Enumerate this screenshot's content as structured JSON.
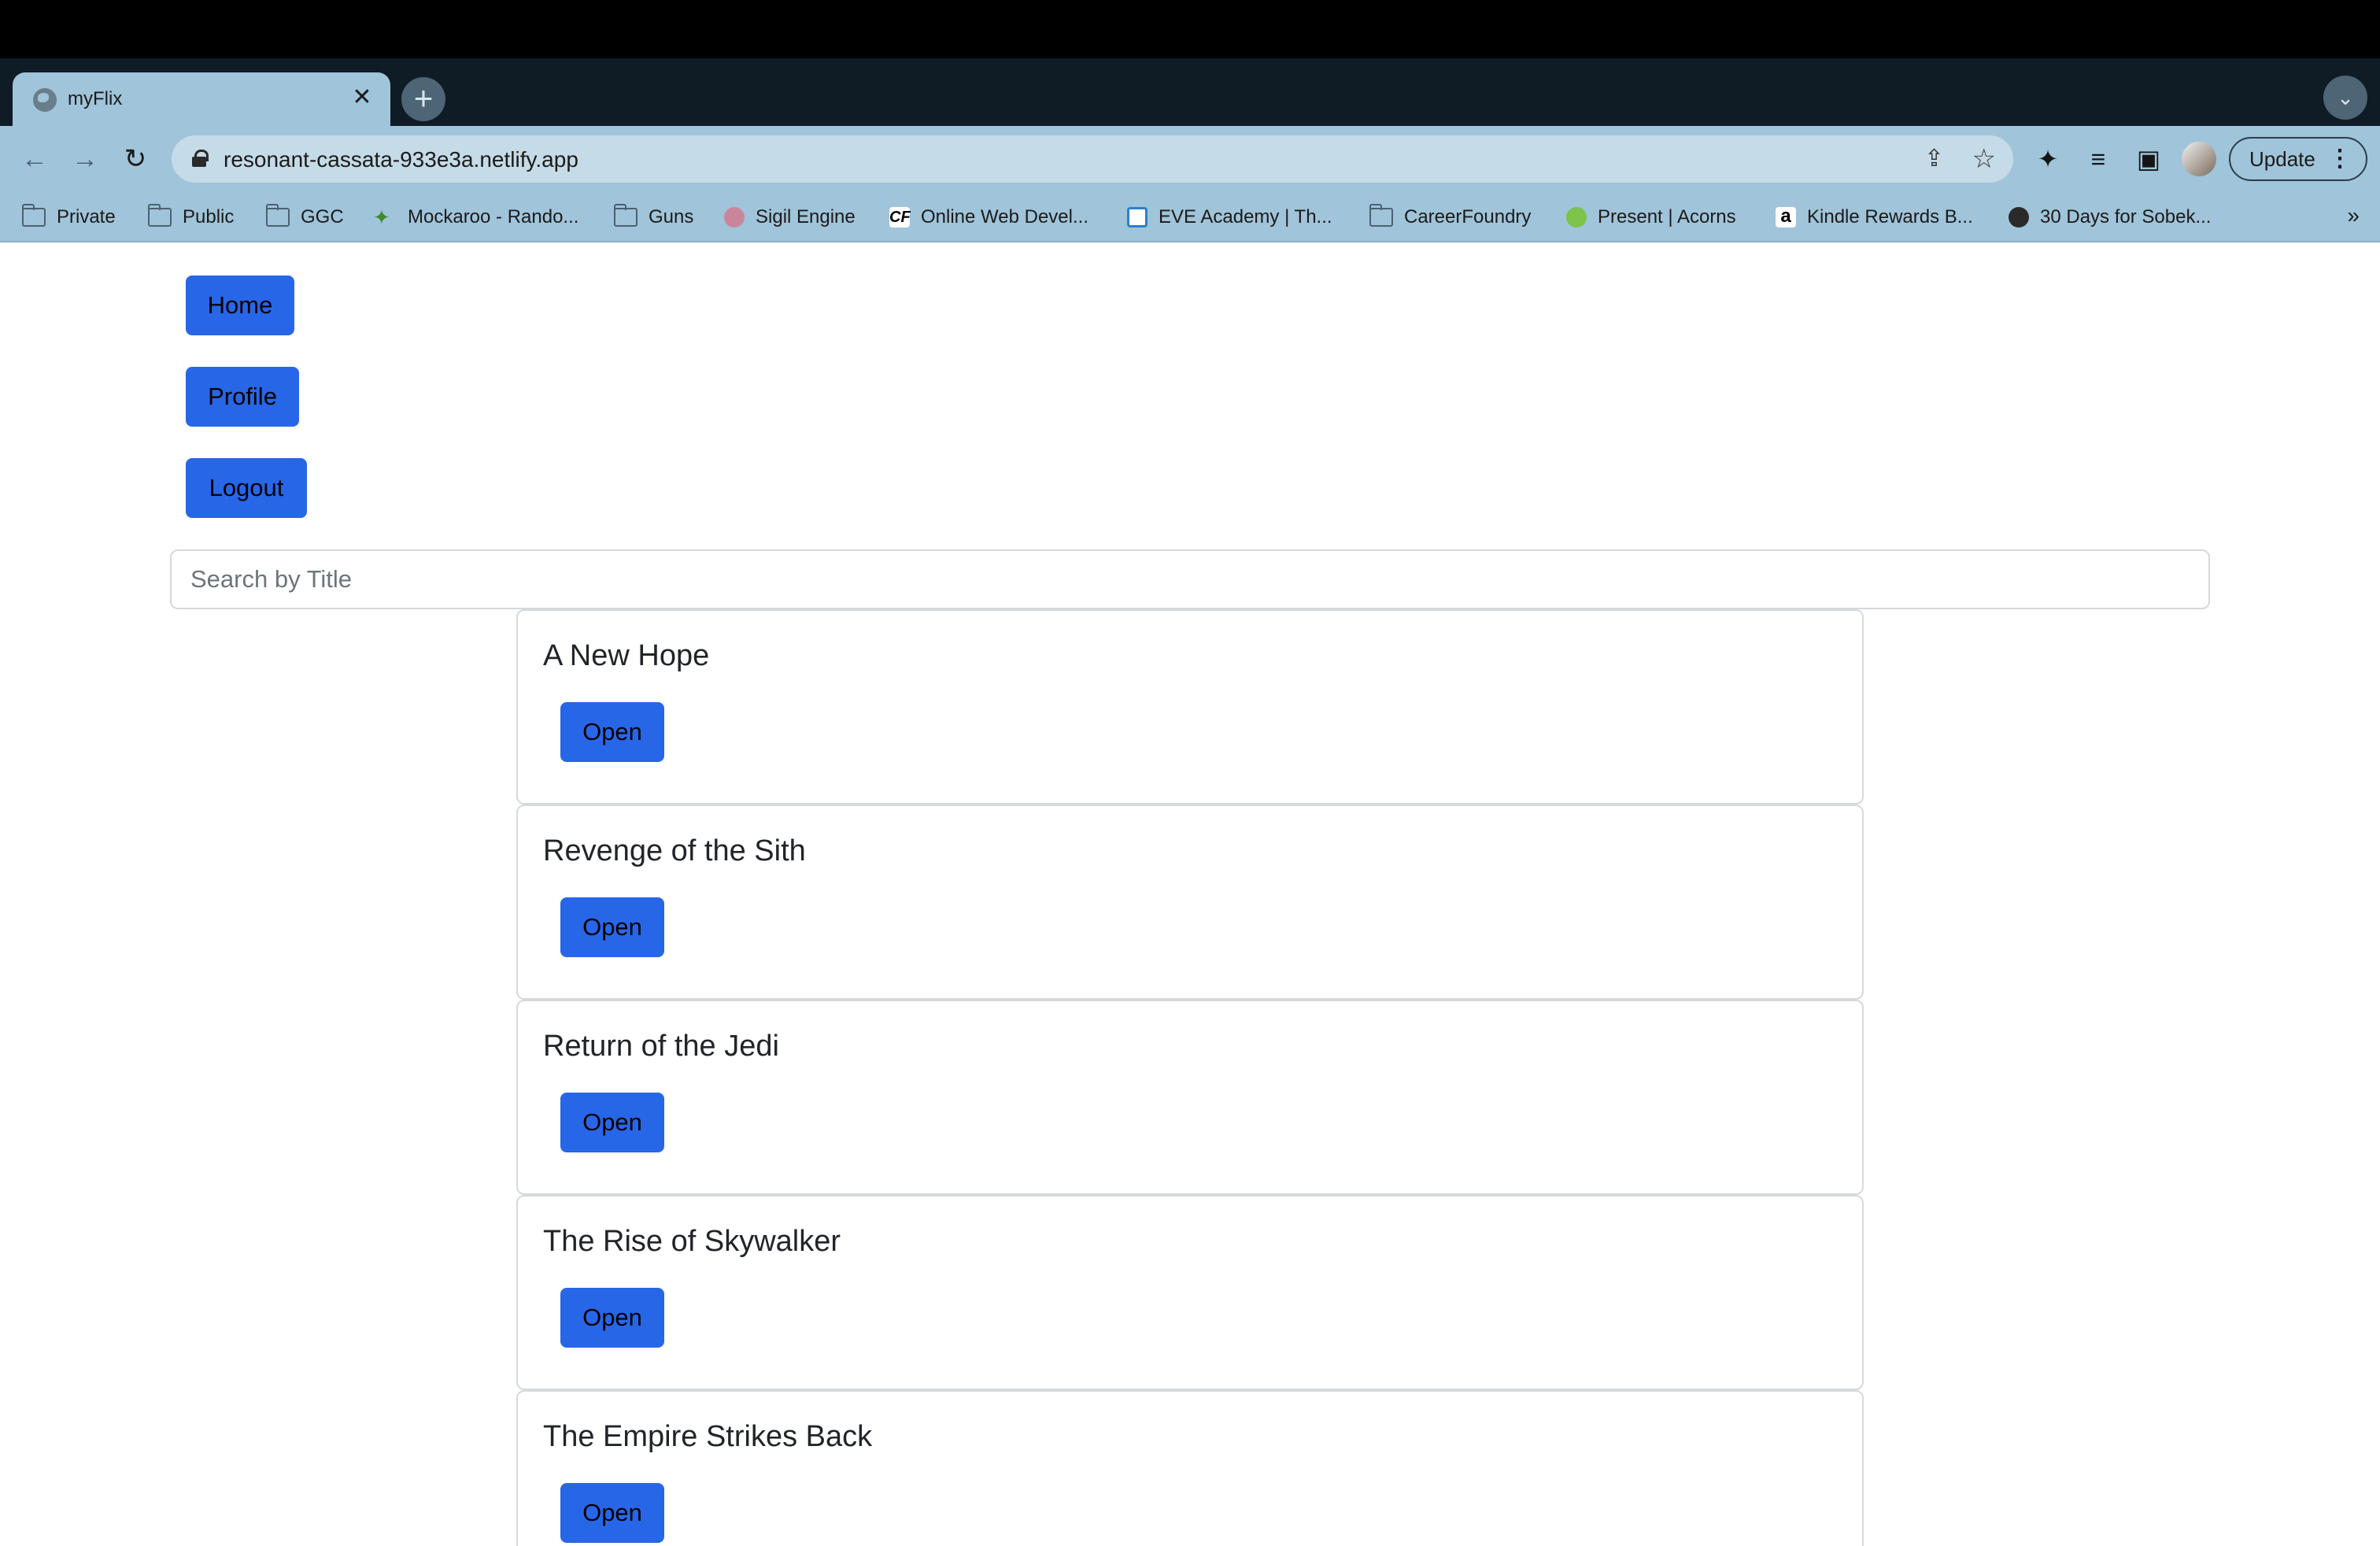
{
  "browser": {
    "tab": {
      "title": "myFlix",
      "close": "✕"
    },
    "new_tab": "+",
    "tab_menu": "⌄",
    "toolbar": {
      "back": "←",
      "forward": "→",
      "reload": "↻",
      "url": "resonant-cassata-933e3a.netlify.app",
      "update_label": "Update",
      "menu": "⋮"
    },
    "bookmarks": [
      {
        "label": "Private",
        "icon": "folder-icon"
      },
      {
        "label": "Public",
        "icon": "folder-icon"
      },
      {
        "label": "GGC",
        "icon": "folder-icon"
      },
      {
        "label": "Mockaroo - Rando...",
        "icon": "mockaroo-icon"
      },
      {
        "label": "Guns",
        "icon": "folder-icon"
      },
      {
        "label": "Sigil Engine",
        "icon": "sigil-icon"
      },
      {
        "label": "Online Web Devel...",
        "icon": "cf-icon",
        "icon_text": "CF"
      },
      {
        "label": "EVE Academy | Th...",
        "icon": "eve-icon"
      },
      {
        "label": "CareerFoundry",
        "icon": "folder-icon"
      },
      {
        "label": "Present | Acorns",
        "icon": "acorns-icon"
      },
      {
        "label": "Kindle Rewards B...",
        "icon": "amazon-icon",
        "icon_text": "a"
      },
      {
        "label": "30 Days for Sobek...",
        "icon": "globe-icon"
      }
    ],
    "bookmarks_more": "»"
  },
  "app": {
    "nav": {
      "home": "Home",
      "profile": "Profile",
      "logout": "Logout"
    },
    "search": {
      "placeholder": "Search by Title",
      "value": ""
    },
    "movies": [
      {
        "title": "A New Hope",
        "button": "Open"
      },
      {
        "title": "Revenge of the Sith",
        "button": "Open"
      },
      {
        "title": "Return of the Jedi",
        "button": "Open"
      },
      {
        "title": "The Rise of Skywalker",
        "button": "Open"
      },
      {
        "title": "The Empire Strikes Back",
        "button": "Open"
      }
    ]
  },
  "colors": {
    "accent": "#2866e8",
    "chrome": "#a0c4d9",
    "tabstrip": "#0f1c26"
  }
}
